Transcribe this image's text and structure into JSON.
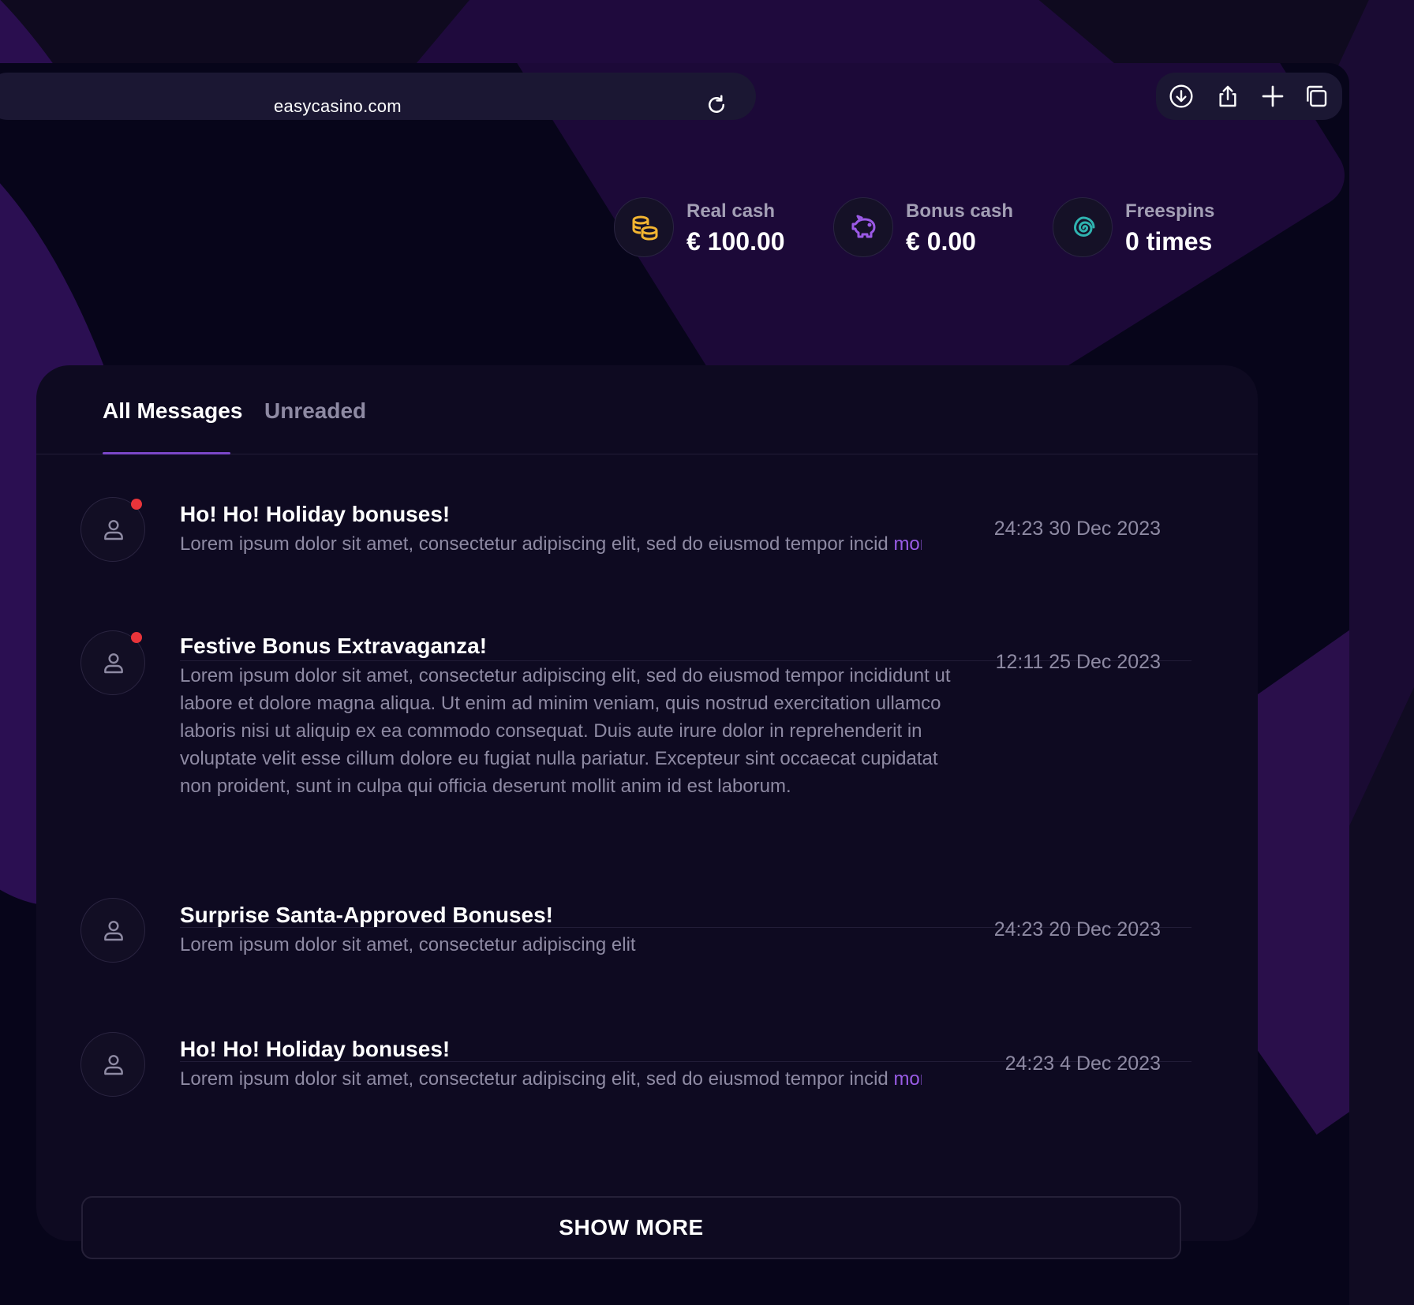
{
  "browser": {
    "url": "easycasino.com",
    "icons": [
      "reload-icon",
      "download-icon",
      "share-icon",
      "new-tab-icon",
      "tabs-icon"
    ]
  },
  "stats": [
    {
      "label": "Real cash",
      "value": "€ 100.00",
      "icon": "coins-icon",
      "color": "#f2b431"
    },
    {
      "label": "Bonus cash",
      "value": "€ 0.00",
      "icon": "piggy-bank-icon",
      "color": "#9b59e6"
    },
    {
      "label": "Freespins",
      "value": "0 times",
      "icon": "spiral-icon",
      "color": "#2fb3b0"
    }
  ],
  "tabs": [
    {
      "label": "All Messages",
      "active": true
    },
    {
      "label": "Unreaded",
      "active": false
    }
  ],
  "messages": [
    {
      "title": "Ho! Ho! Holiday bonuses!",
      "body": "Lorem ipsum dolor sit amet, consectetur adipiscing elit, sed do eiusmod tempor incid",
      "more": "more",
      "date": "24:23 30 Dec 2023",
      "unread": true
    },
    {
      "title": "Festive Bonus Extravaganza!",
      "body": "Lorem ipsum dolor sit amet, consectetur adipiscing elit, sed do eiusmod tempor incididunt ut labore et dolore magna aliqua. Ut enim ad minim veniam, quis nostrud exercitation ullamco laboris nisi ut aliquip ex ea commodo consequat. Duis aute irure dolor in reprehenderit in voluptate velit esse cillum dolore eu fugiat nulla pariatur. Excepteur sint occaecat cupidatat non proident, sunt in culpa qui officia deserunt mollit anim id est laborum.",
      "date": "12:11 25 Dec 2023",
      "unread": true
    },
    {
      "title": "Surprise Santa-Approved Bonuses!",
      "body": "Lorem ipsum dolor sit amet, consectetur adipiscing elit",
      "date": "24:23 20 Dec 2023",
      "unread": false
    },
    {
      "title": "Ho! Ho! Holiday bonuses!",
      "body": "Lorem ipsum dolor sit amet, consectetur adipiscing elit, sed do eiusmod tempor incid",
      "more": "more",
      "date": "24:23 4 Dec 2023",
      "unread": false
    }
  ],
  "show_more_label": "SHOW MORE",
  "colors": {
    "accent": "#7b47c9",
    "unread_dot": "#e8343a",
    "background": "#07051a"
  }
}
